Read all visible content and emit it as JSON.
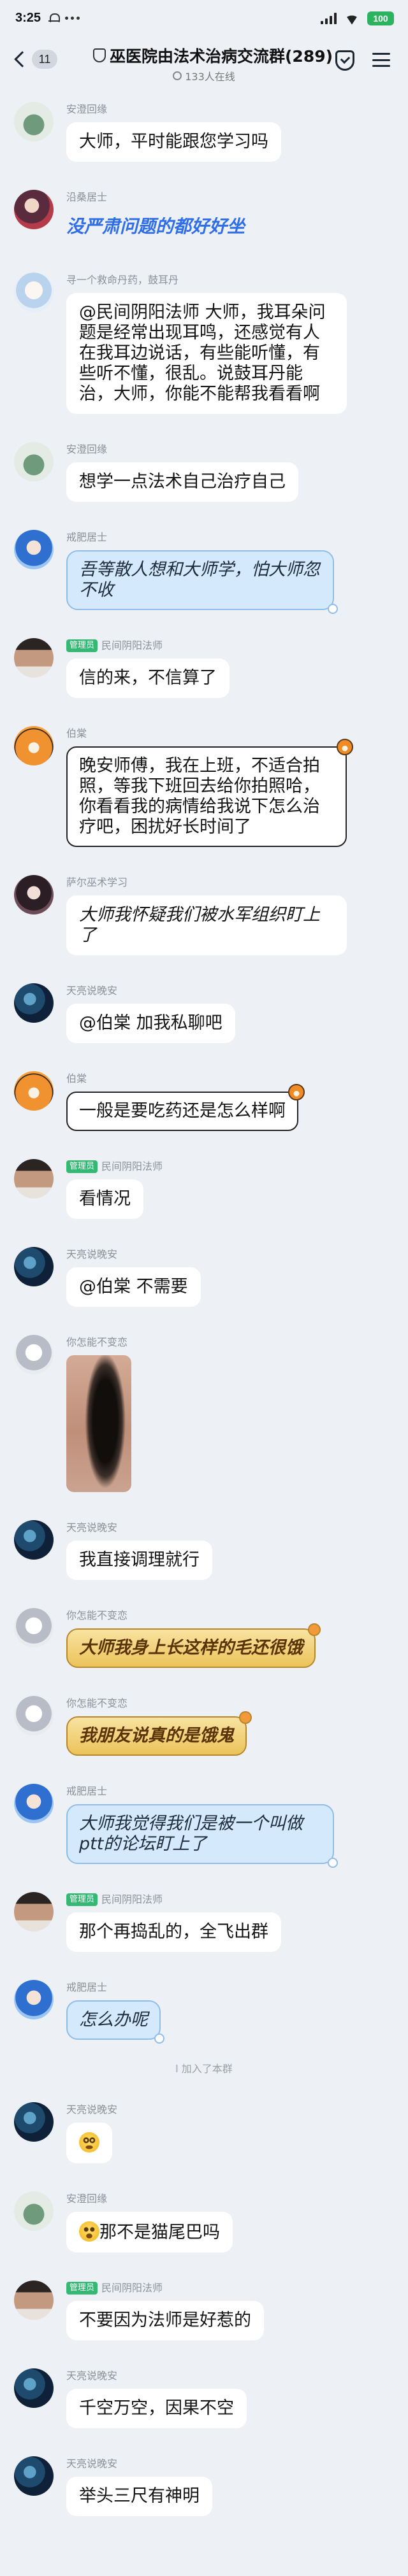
{
  "status_bar": {
    "time": "3:25",
    "battery": "100"
  },
  "header": {
    "unread_count": "11",
    "title": "巫医院由法术治病交流群(289)",
    "online": "133人在线"
  },
  "colors": {
    "background": "#edf0f5",
    "admin_badge": "#35b874",
    "styled_text": "#2f6ee8"
  },
  "messages": [
    {
      "sender": "安澄回缘",
      "text": "大师，平时能跟您学习吗"
    },
    {
      "sender": "沿桑居士",
      "text": "没严肃问题的都好好坐"
    },
    {
      "sender": "寻一个救命丹药，鼓耳丹",
      "text": "@民间阴阳法师 大师，我耳朵问题是经常出现耳鸣，还感觉有人在我耳边说话，有些能听懂，有些听不懂，很乱。说鼓耳丹能治，大师，你能不能帮我看看啊"
    },
    {
      "sender": "安澄回缘",
      "text": "想学一点法术自己治疗自己"
    },
    {
      "sender": "戒肥居士",
      "text": "吾等散人想和大师学，怕大师忽不收"
    },
    {
      "sender": "民间阴阳法师",
      "badge": "管理员",
      "text": "信的来，不信算了"
    },
    {
      "sender": "伯棠",
      "text": "晚安师傅，我在上班，不适合拍照，等我下班回去给你拍照哈，你看看我的病情给我说下怎么治疗吧，困扰好长时间了"
    },
    {
      "sender": "萨尔巫术学习",
      "text": "大师我怀疑我们被水军组织盯上了"
    },
    {
      "sender": "天亮说晚安",
      "text": "@伯棠 加我私聊吧"
    },
    {
      "sender": "伯棠",
      "text": "一般是要吃药还是怎么样啊"
    },
    {
      "sender": "民间阴阳法师",
      "badge": "管理员",
      "text": "看情况"
    },
    {
      "sender": "天亮说晚安",
      "text": "@伯棠 不需要"
    },
    {
      "sender": "你怎能不变恋"
    },
    {
      "sender": "天亮说晚安",
      "text": "我直接调理就行"
    },
    {
      "sender": "你怎能不变恋",
      "text": "大师我身上长这样的毛还很饿"
    },
    {
      "sender": "你怎能不变恋",
      "text": "我朋友说真的是饿鬼"
    },
    {
      "sender": "戒肥居士",
      "text": "大师我觉得我们是被一个叫做ptt的论坛盯上了"
    },
    {
      "sender": "民间阴阳法师",
      "badge": "管理员",
      "text": "那个再捣乱的，全飞出群"
    },
    {
      "sender": "戒肥居士",
      "text": "怎么办呢"
    },
    {
      "sender": "天亮说晚安",
      "emoji": "dizzy-face-emoji"
    },
    {
      "sender": "安澄回缘",
      "emoji": "astonished-face-emoji",
      "text": "那不是猫尾巴吗"
    },
    {
      "sender": "民间阴阳法师",
      "badge": "管理员",
      "text": "不要因为法师是好惹的"
    },
    {
      "sender": "天亮说晚安",
      "text": "千空万空，因果不空"
    },
    {
      "sender": "天亮说晚安",
      "text": "举头三尺有神明"
    }
  ],
  "system_notice": "l 加入了本群"
}
